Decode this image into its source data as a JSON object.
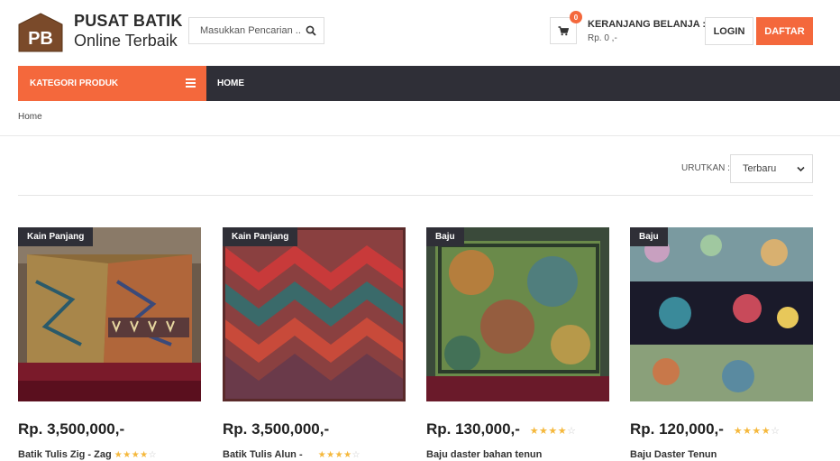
{
  "brand": {
    "logo_text": "PB",
    "title": "PUSAT BATIK",
    "subtitle": "Online Terbaik"
  },
  "search": {
    "placeholder": "Masukkan Pencarian ..",
    "icon": "search-icon"
  },
  "cart": {
    "icon": "cart-icon",
    "count": "0",
    "title": "KERANJANG BELANJA :",
    "total": "Rp. 0 ,-"
  },
  "auth": {
    "login": "LOGIN",
    "register": "DAFTAR"
  },
  "nav": {
    "category_label": "KATEGORI PRODUK",
    "category_icon": "list-icon",
    "home": "HOME"
  },
  "breadcrumb": {
    "home": "Home"
  },
  "sort": {
    "label": "URUTKAN :",
    "selected": "Terbaru",
    "icon": "chevron-down-icon"
  },
  "colors": {
    "accent": "#f4683c",
    "dark": "#2f2f37",
    "star": "#f5b83c"
  },
  "products": [
    {
      "tag": "Kain Panjang",
      "price": "Rp. 3,500,000,-",
      "name": "Batik Tulis Zig - Zag",
      "rating": 4
    },
    {
      "tag": "Kain Panjang",
      "price": "Rp. 3,500,000,-",
      "name": "Batik Tulis Alun -",
      "rating": 4
    },
    {
      "tag": "Baju",
      "price": "Rp. 130,000,-",
      "name": "Baju daster bahan tenun",
      "rating": 4
    },
    {
      "tag": "Baju",
      "price": "Rp. 120,000,-",
      "name": "Baju Daster Tenun",
      "rating": 4
    }
  ]
}
